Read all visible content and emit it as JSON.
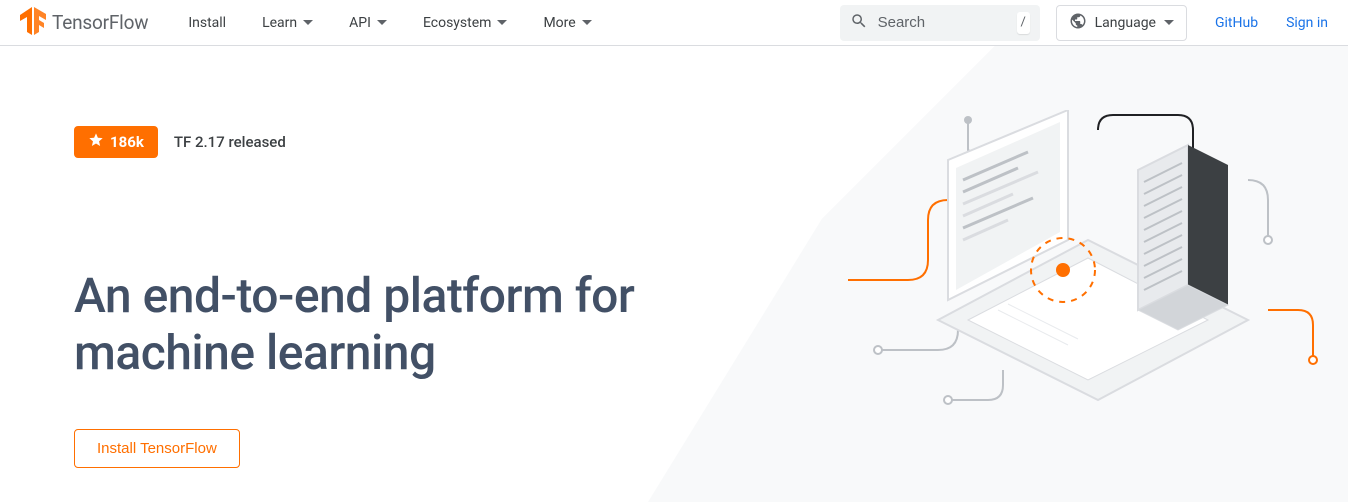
{
  "header": {
    "brand": "TensorFlow",
    "nav": {
      "install": "Install",
      "learn": "Learn",
      "api": "API",
      "ecosystem": "Ecosystem",
      "more": "More"
    },
    "search_placeholder": "Search",
    "search_shortcut": "/",
    "language_label": "Language",
    "github": "GitHub",
    "signin": "Sign in"
  },
  "hero": {
    "star_count": "186k",
    "release_note": "TF 2.17 released",
    "title": "An end-to-end platform for machine learning",
    "install_button": "Install TensorFlow"
  },
  "colors": {
    "accent": "#ff6f00",
    "link": "#1a73e8",
    "text_muted": "#5f6368",
    "heading": "#425066"
  }
}
